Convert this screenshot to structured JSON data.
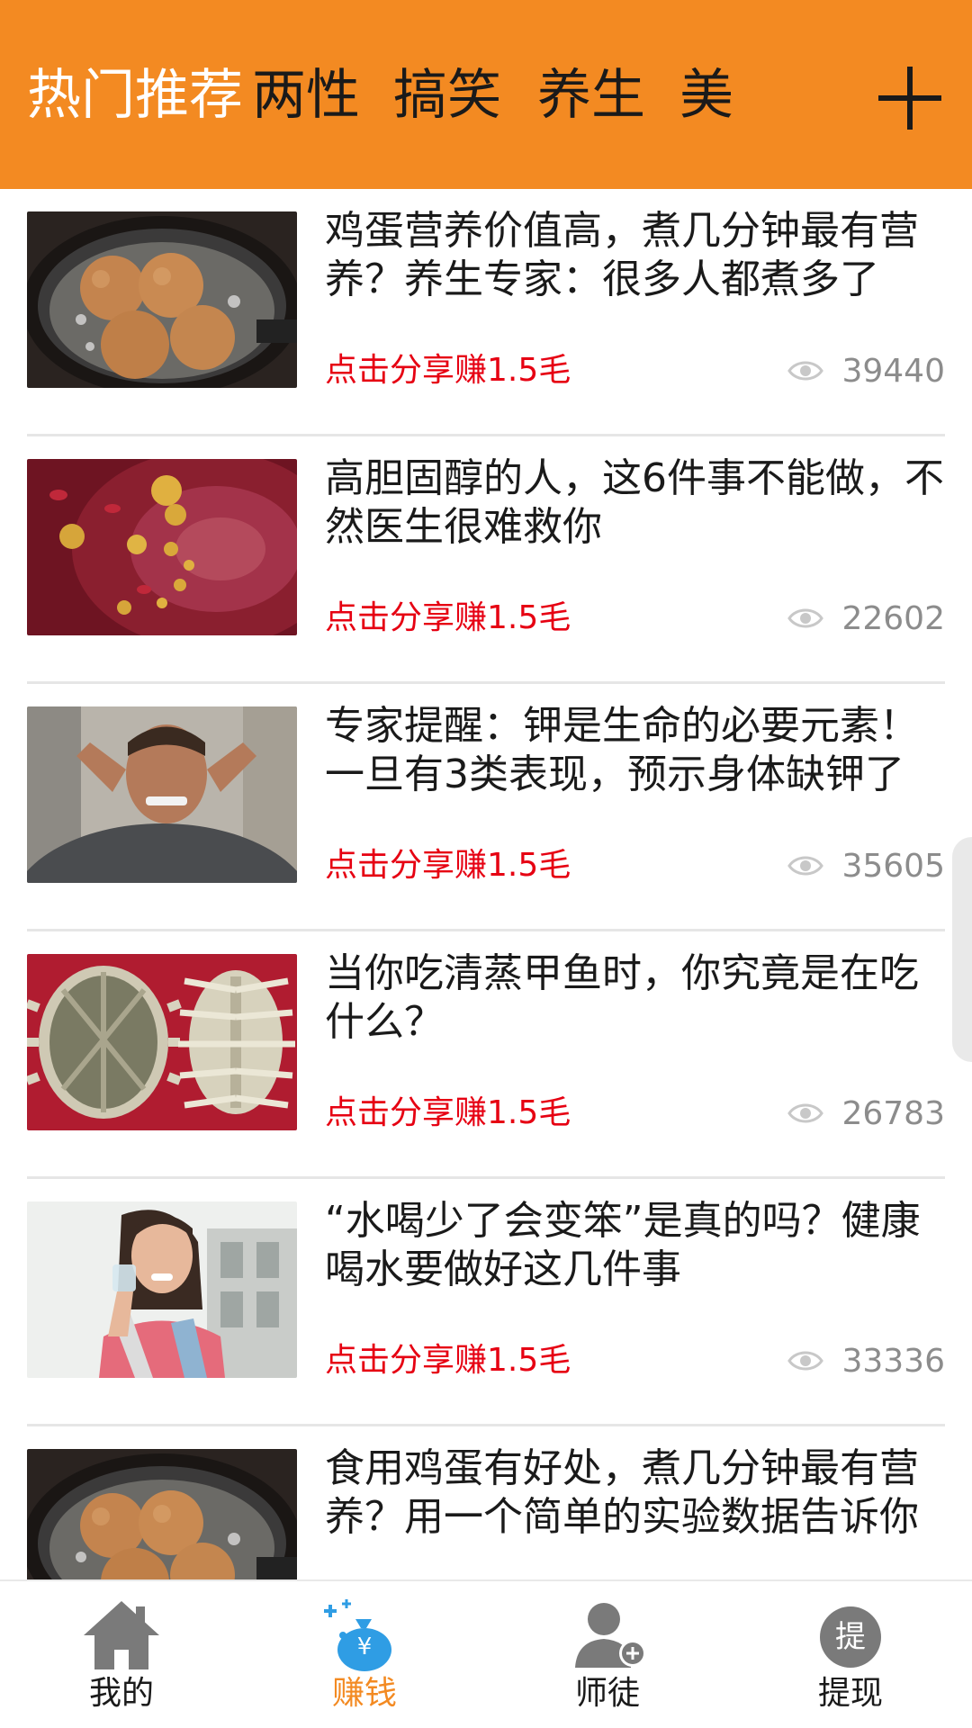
{
  "top_tabs": {
    "items": [
      {
        "label": "热门推荐",
        "active": true
      },
      {
        "label": "两性"
      },
      {
        "label": "搞笑"
      },
      {
        "label": "养生"
      },
      {
        "label": "美"
      }
    ],
    "add_icon": "plus-icon"
  },
  "articles": [
    {
      "title": "鸡蛋营养价值高，煮几分钟最有营养？养生专家：很多人都煮多了",
      "reward": "点击分享赚1.5毛",
      "views": "39440",
      "thumb": "boiling-eggs"
    },
    {
      "title": "高胆固醇的人，这6件事不能做，不然医生很难救你",
      "reward": "点击分享赚1.5毛",
      "views": "22602",
      "thumb": "blood-vessel"
    },
    {
      "title": "专家提醒：钾是生命的必要元素！一旦有3类表现，预示身体缺钾了",
      "reward": "点击分享赚1.5毛",
      "views": "35605",
      "thumb": "man-headache"
    },
    {
      "title": "当你吃清蒸甲鱼时，你究竟是在吃什么？",
      "reward": "点击分享赚1.5毛",
      "views": "26783",
      "thumb": "turtle-shell"
    },
    {
      "title": "“水喝少了会变笨”是真的吗？健康喝水要做好这几件事",
      "reward": "点击分享赚1.5毛",
      "views": "33336",
      "thumb": "woman-drinking-water"
    },
    {
      "title": "食用鸡蛋有好处，煮几分钟最有营养？用一个简单的实验数据告诉你",
      "thumb": "boiling-eggs"
    }
  ],
  "bottom_nav": {
    "items": [
      {
        "label": "我的",
        "icon": "home-icon"
      },
      {
        "label": "赚钱",
        "icon": "money-bag-icon",
        "active": true
      },
      {
        "label": "师徒",
        "icon": "add-person-icon"
      },
      {
        "label": "提现",
        "icon": "withdraw-icon",
        "icon_text": "提"
      }
    ]
  },
  "colors": {
    "brand": "#f38a22",
    "reward": "#e60012",
    "muted": "#8c8c8c"
  }
}
